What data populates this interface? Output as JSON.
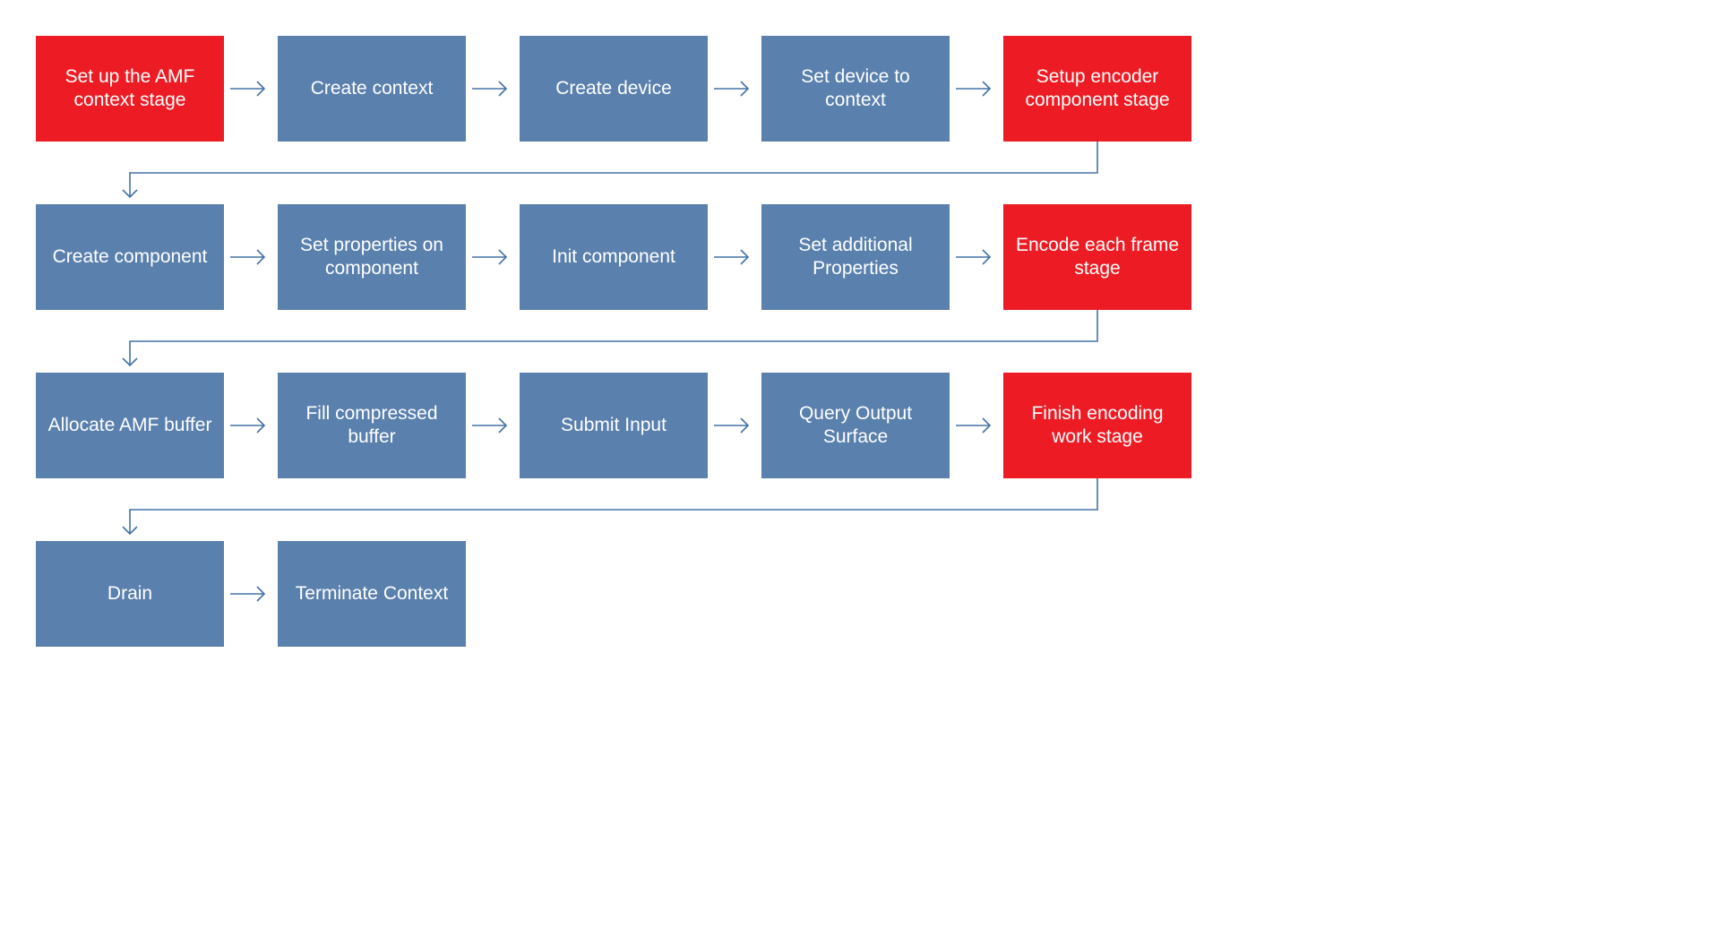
{
  "colors": {
    "blue": "#5A80AD",
    "red": "#ED1C24",
    "arrow": "#4472A8"
  },
  "rows": [
    {
      "boxes": [
        {
          "label": "Set up the AMF context stage",
          "style": "red"
        },
        {
          "label": "Create context",
          "style": "blue"
        },
        {
          "label": "Create device",
          "style": "blue"
        },
        {
          "label": "Set device to context",
          "style": "blue"
        },
        {
          "label": "Setup encoder component stage",
          "style": "red"
        }
      ]
    },
    {
      "boxes": [
        {
          "label": "Create component",
          "style": "blue"
        },
        {
          "label": "Set properties on component",
          "style": "blue"
        },
        {
          "label": "Init component",
          "style": "blue"
        },
        {
          "label": "Set additional Properties",
          "style": "blue"
        },
        {
          "label": "Encode each frame stage",
          "style": "red"
        }
      ]
    },
    {
      "boxes": [
        {
          "label": "Allocate AMF buffer",
          "style": "blue"
        },
        {
          "label": "Fill compressed buffer",
          "style": "blue"
        },
        {
          "label": "Submit Input",
          "style": "blue"
        },
        {
          "label": "Query  Output Surface",
          "style": "blue"
        },
        {
          "label": "Finish encoding work stage",
          "style": "red"
        }
      ]
    },
    {
      "boxes": [
        {
          "label": "Drain",
          "style": "blue"
        },
        {
          "label": "Terminate Context",
          "style": "blue"
        }
      ]
    }
  ]
}
